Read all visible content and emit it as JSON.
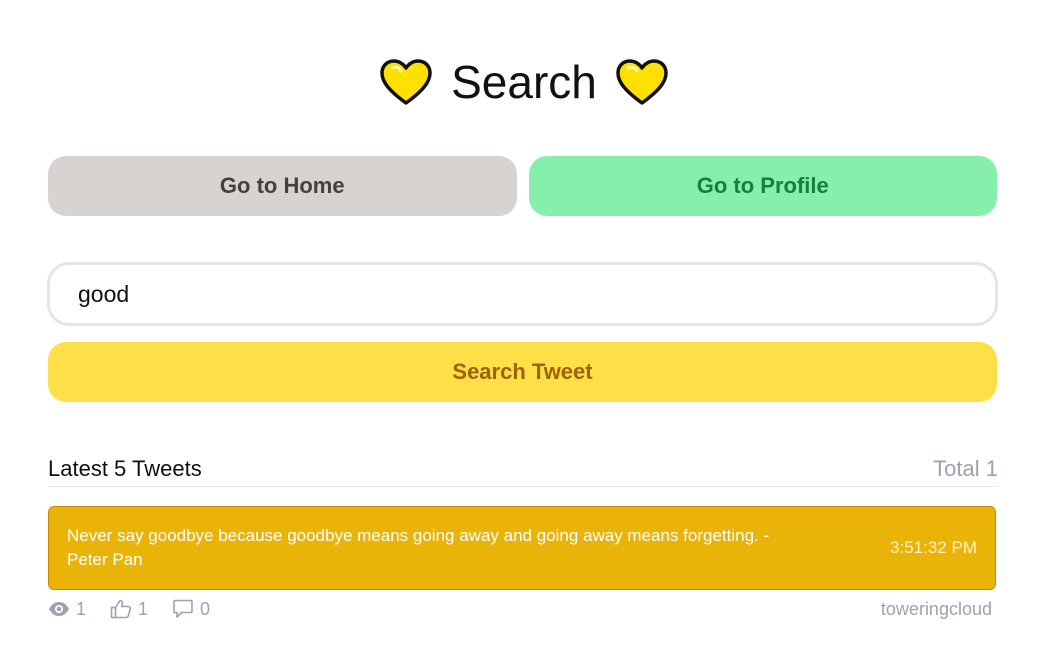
{
  "header": {
    "title": "Search",
    "left_icon": "yellow-heart-icon",
    "right_icon": "yellow-heart-icon",
    "heart_color": "#ffe000"
  },
  "nav": {
    "home_label": "Go to Home",
    "profile_label": "Go to Profile"
  },
  "search": {
    "value": "good",
    "button_label": "Search Tweet"
  },
  "results": {
    "heading": "Latest 5 Tweets",
    "total": "Total 1",
    "tweets": [
      {
        "text": "Never say goodbye because goodbye means going away and going away means forgetting. - Peter Pan",
        "time": "3:51:32 PM",
        "views": "1",
        "likes": "1",
        "comments": "0",
        "author": "toweringcloud"
      }
    ]
  },
  "colors": {
    "home_button": "#d7d3d0",
    "profile_button": "#86efac",
    "search_button": "#fde047",
    "tweet_card": "#eab308"
  }
}
